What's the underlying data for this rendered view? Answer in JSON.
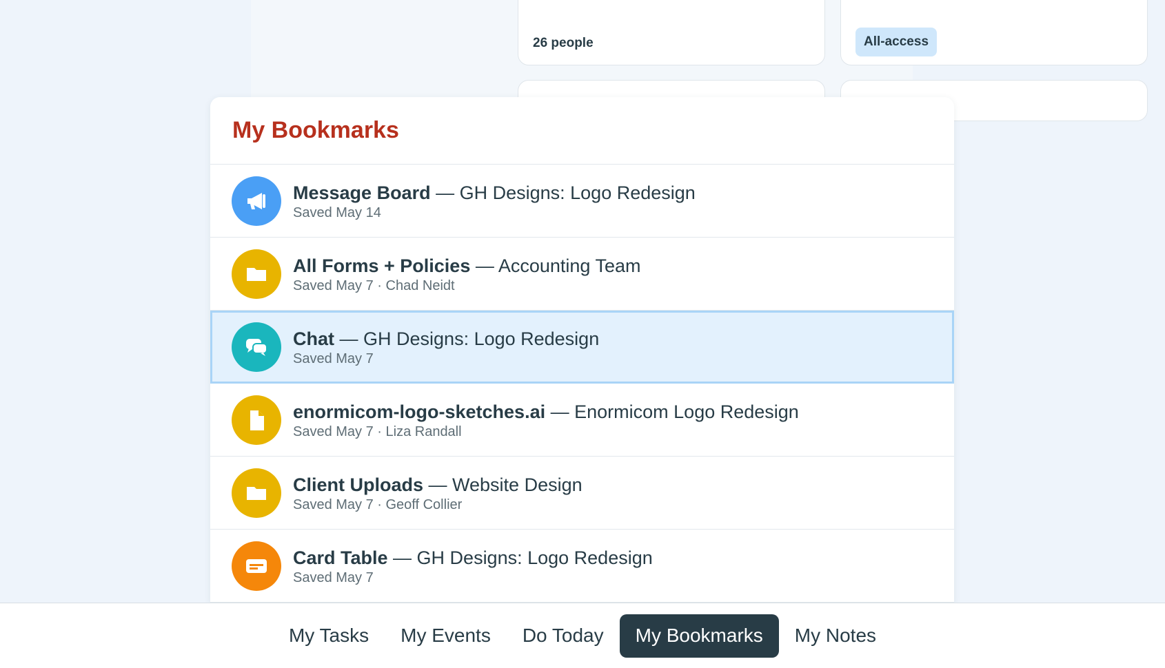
{
  "background_cards": {
    "people_count": "26 people",
    "access_badge": "All-access"
  },
  "bookmarks": {
    "title": "My Bookmarks",
    "items": [
      {
        "name": "Message Board",
        "separator": " — ",
        "context": "GH Designs: Logo Redesign",
        "meta": "Saved May 14",
        "icon": "megaphone-icon",
        "color": "#4a9ff5"
      },
      {
        "name": "All Forms + Policies",
        "separator": " — ",
        "context": "Accounting Team",
        "meta": "Saved May 7 · Chad Neidt",
        "icon": "folder-icon",
        "color": "#e8b400"
      },
      {
        "name": "Chat",
        "separator": " — ",
        "context": "GH Designs: Logo Redesign",
        "meta": "Saved May 7",
        "icon": "chat-bubbles-icon",
        "color": "#1ab6bd"
      },
      {
        "name": "enormicom-logo-sketches.ai",
        "separator": " — ",
        "context": "Enormicom Logo Redesign",
        "meta": "Saved May 7 · Liza Randall",
        "icon": "document-icon",
        "color": "#e8b400"
      },
      {
        "name": "Client Uploads",
        "separator": " — ",
        "context": "Website Design",
        "meta": "Saved May 7 · Geoff Collier",
        "icon": "folder-icon",
        "color": "#e8b400"
      },
      {
        "name": "Card Table",
        "separator": " — ",
        "context": "GH Designs: Logo Redesign",
        "meta": "Saved May 7",
        "icon": "card-table-icon",
        "color": "#f5870a"
      }
    ]
  },
  "tabs": [
    "My Tasks",
    "My Events",
    "Do Today",
    "My Bookmarks",
    "My Notes"
  ],
  "active_tab": "My Bookmarks",
  "colors": {
    "title_red": "#b7301d",
    "selected_row_bg": "#e3f1fd",
    "active_tab_bg": "#283c46"
  }
}
